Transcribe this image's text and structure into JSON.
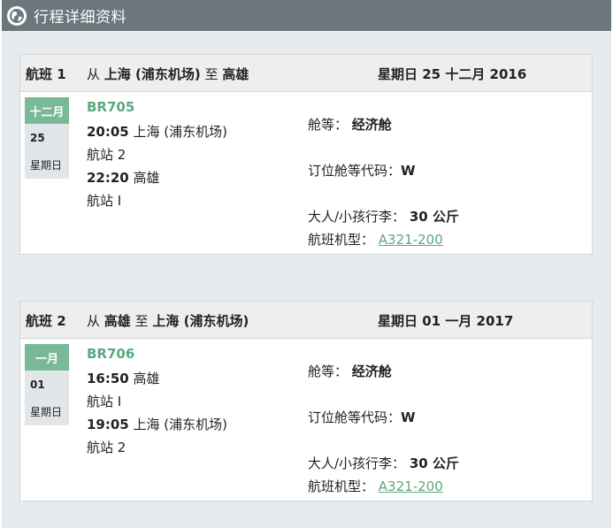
{
  "header": {
    "title": "行程详细资料",
    "icon": "globe-icon"
  },
  "colors": {
    "header_bg": "#6b777c",
    "accent": "#5aa87f",
    "month_bg": "#79b998"
  },
  "flights": [
    {
      "label": "航班 1",
      "from_word": "从",
      "origin": "上海 (浦东机场)",
      "to_word": "至",
      "destination": "高雄",
      "date": "星期日 25 十二月 2016",
      "date_month": "十二月",
      "date_day": "25",
      "date_weekday": "星期日",
      "flight_no": "BR705",
      "dep_time": "20:05",
      "dep_place": "上海 (浦东机场)",
      "dep_terminal": "航站 2",
      "arr_time": "22:20",
      "arr_place": "高雄",
      "arr_terminal": "航站 I",
      "cabin_label": "舱等：",
      "cabin_value": "经济舱",
      "booking_label": "订位舱等代码：",
      "booking_value": "W",
      "baggage_label": "大人/小孩行李：",
      "baggage_value": "30 公斤",
      "aircraft_label": "航班机型：",
      "aircraft_value": "A321-200"
    },
    {
      "label": "航班 2",
      "from_word": "从",
      "origin": "高雄",
      "to_word": "至",
      "destination": "上海 (浦东机场)",
      "date": "星期日 01 一月 2017",
      "date_month": "一月",
      "date_day": "01",
      "date_weekday": "星期日",
      "flight_no": "BR706",
      "dep_time": "16:50",
      "dep_place": "高雄",
      "dep_terminal": "航站 I",
      "arr_time": "19:05",
      "arr_place": "上海 (浦东机场)",
      "arr_terminal": "航站 2",
      "cabin_label": "舱等：",
      "cabin_value": "经济舱",
      "booking_label": "订位舱等代码：",
      "booking_value": "W",
      "baggage_label": "大人/小孩行李：",
      "baggage_value": "30 公斤",
      "aircraft_label": "航班机型：",
      "aircraft_value": "A321-200"
    }
  ]
}
